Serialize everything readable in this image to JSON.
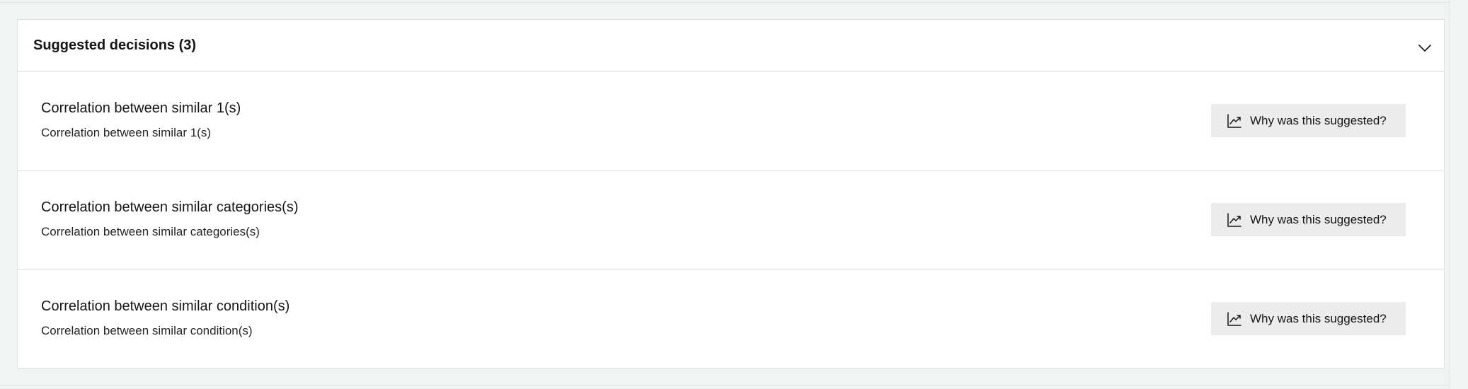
{
  "panel": {
    "title": "Suggested decisions (3)",
    "collapse_icon": "chevron-down-icon"
  },
  "decisions": [
    {
      "title": "Correlation between similar 1(s)",
      "subtitle": "Correlation between similar 1(s)",
      "button_label": "Why was this suggested?",
      "button_icon": "trending-chart-icon"
    },
    {
      "title": "Correlation between similar categories(s)",
      "subtitle": "Correlation between similar categories(s)",
      "button_label": "Why was this suggested?",
      "button_icon": "trending-chart-icon"
    },
    {
      "title": "Correlation between similar condition(s)",
      "subtitle": "Correlation between similar condition(s)",
      "button_label": "Why was this suggested?",
      "button_icon": "trending-chart-icon"
    }
  ]
}
